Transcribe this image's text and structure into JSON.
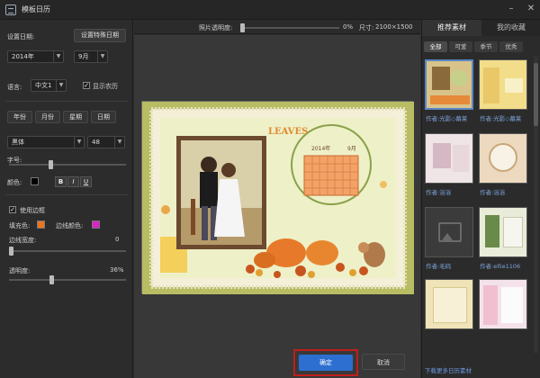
{
  "window": {
    "title": "模板日历"
  },
  "left": {
    "date_label": "设置日期:",
    "special_date_button": "设置特殊日期",
    "year_value": "2014年",
    "month_value": "9月",
    "language_label": "语言:",
    "language_value": "中文1",
    "show_lunar_label": "显示农历",
    "show_lunar_checked": true,
    "date_parts": [
      "年份",
      "月份",
      "星期",
      "日期"
    ],
    "font_value": "黑体",
    "font_size_value": "48",
    "font_size_label": "字号:",
    "color_label": "颜色:",
    "font_color": "#000000",
    "format_buttons": [
      "B",
      "I",
      "U"
    ],
    "use_border_label": "使用边框",
    "use_border_checked": true,
    "fill_color_label": "填充色:",
    "fill_color": "#e8761f",
    "border_color_label": "边线颜色:",
    "border_color": "#e020c8",
    "border_width_label": "边线宽度:",
    "border_width_value": "0",
    "opacity_label": "透明度:",
    "opacity_value": "36%",
    "opacity_fraction": 0.36,
    "font_size_fraction": 0.35
  },
  "toolbar": {
    "photo_opacity_label": "照片透明度:",
    "photo_opacity_value": "0%",
    "size_label": "尺寸:",
    "size_value": "2100×1500"
  },
  "preview": {
    "year_text": "2014年",
    "month_text": "9月",
    "deco_text": "LEAVES",
    "accent_orange": "#e67a2a",
    "background_olive": "#b4ba61"
  },
  "right": {
    "tabs": [
      "推荐素材",
      "我的收藏"
    ],
    "categories": [
      "全部",
      "可爱",
      "季节",
      "优秀"
    ],
    "thumbnails": [
      {
        "author": "作者:光影◇幕莱",
        "selected": true
      },
      {
        "author": "作者:光影◇幕莱",
        "selected": false
      },
      {
        "author": "作者:浴浴",
        "selected": false
      },
      {
        "author": "作者:浴浴",
        "selected": false
      },
      {
        "author": "作者:毛码",
        "selected": false
      },
      {
        "author": "作者:ellie1106",
        "selected": false
      },
      {
        "author": "",
        "selected": false
      },
      {
        "author": "",
        "selected": false
      }
    ]
  },
  "footer": {
    "ok_label": "确定",
    "cancel_label": "取消",
    "more_link": "下载更多日历素材"
  }
}
